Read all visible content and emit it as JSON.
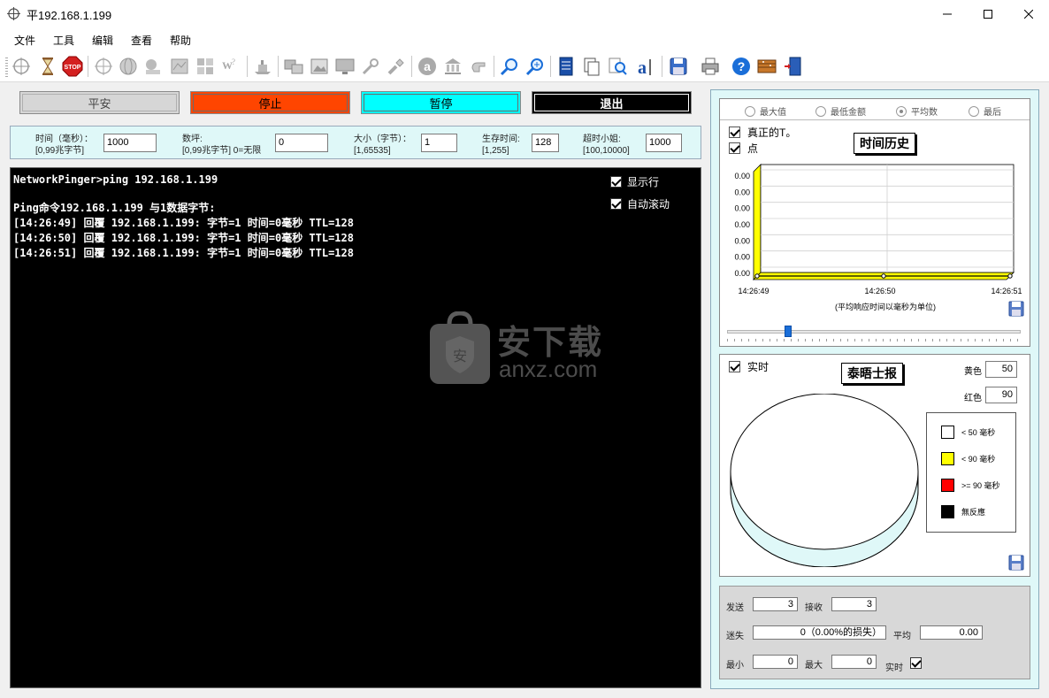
{
  "window": {
    "title": "平192.168.1.199"
  },
  "menu": [
    "文件",
    "工具",
    "编辑",
    "查看",
    "帮助"
  ],
  "toolbar_icons": [
    "ping-target-icon",
    "hourglass-icon",
    "stop-sign-icon",
    "target-icon",
    "globe-icon",
    "tracert-icon",
    "map-icon",
    "grid-icon",
    "whois-icon",
    "ships-icon",
    "monitor-icon",
    "image-icon",
    "screen-icon",
    "tools-icon",
    "flashlight-icon",
    "letter-a-icon",
    "building-icon",
    "hand-icon",
    "magnify-icon",
    "magnify-plus-icon",
    "server-icon",
    "copy-icon",
    "find-icon",
    "text-a-icon",
    "save-icon",
    "printer-icon",
    "help-icon",
    "options-icon",
    "exit-door-icon"
  ],
  "actions": {
    "safe": "平安",
    "stop": "停止",
    "pause": "暂停",
    "exit": "退出"
  },
  "params": {
    "time_label": "时间（毫秒）：",
    "time_range": "[0,99兆字节]",
    "time_value": "1000",
    "count_label": "数坪:",
    "count_range": "[0,99兆字节] 0=无限",
    "count_value": "0",
    "size_label": "大小（字节）：",
    "size_range": "[1,65535]",
    "size_value": "1",
    "ttl_label": "生存时间:",
    "ttl_range": "[1,255]",
    "ttl_value": "128",
    "timeout_label": "超时小姐:",
    "timeout_range": "[100,10000]",
    "timeout_value": "1000"
  },
  "console": {
    "lines": [
      "NetworkPinger>ping 192.168.1.199",
      "",
      "Ping命令192.168.1.199 与1数据字节:",
      "[14:26:49] 回覆 192.168.1.199: 字节=1 时间=0毫秒 TTL=128",
      "[14:26:50] 回覆 192.168.1.199: 字节=1 时间=0毫秒 TTL=128",
      "[14:26:51] 回覆 192.168.1.199: 字节=1 时间=0毫秒 TTL=128"
    ],
    "show_lines_label": "显示行",
    "show_lines_checked": true,
    "autoscroll_label": "自动滚动",
    "autoscroll_checked": true
  },
  "watermark": {
    "cn": "安下载",
    "en": "anxz.com"
  },
  "history": {
    "radios": [
      {
        "label": "最大值",
        "checked": false
      },
      {
        "label": "最低金额",
        "checked": false
      },
      {
        "label": "平均数",
        "checked": true
      },
      {
        "label": "最后",
        "checked": false
      }
    ],
    "real_t_label": "真正的T。",
    "real_t_checked": true,
    "points_label": "点",
    "points_checked": true,
    "title": "时间历史",
    "caption": "(平均响应时间以毫秒为单位)"
  },
  "chart_data": {
    "type": "line",
    "title": "时间历史",
    "xlabel": "(平均响应时间以毫秒为单位)",
    "ylabel": "",
    "x": [
      "14:26:49",
      "14:26:50",
      "14:26:51"
    ],
    "series": [
      {
        "values": [
          0,
          0,
          0
        ]
      }
    ],
    "y_ticks": [
      "0.00",
      "0.00",
      "0.00",
      "0.00",
      "0.00",
      "0.00",
      "0.00"
    ],
    "ylim": [
      0,
      0
    ],
    "grid": true,
    "colors": {
      "wall": "#ffff00",
      "line": "#000000"
    }
  },
  "slider": {
    "value": 0.2
  },
  "pie": {
    "realtime_label": "实时",
    "realtime_checked": true,
    "title": "泰晤士报",
    "yellow_label": "黄色",
    "yellow_value": "50",
    "red_label": "红色",
    "red_value": "90",
    "legend": [
      {
        "label": "< 50 毫秒",
        "color": "#ffffff"
      },
      {
        "label": "< 90 毫秒",
        "color": "#ffff00"
      },
      {
        "label": ">= 90 毫秒",
        "color": "#ff0000"
      },
      {
        "label": "無反應",
        "color": "#000000"
      }
    ]
  },
  "stats": {
    "sent_label": "发送",
    "sent_value": "3",
    "received_label": "接收",
    "received_value": "3",
    "lost_label": "迷失",
    "lost_value": "0（0.00%的损失）",
    "avg_label": "平均",
    "avg_value": "0.00",
    "min_label": "最小",
    "min_value": "0",
    "max_label": "最大",
    "max_value": "0",
    "realtime_label": "实时",
    "realtime_checked": true
  }
}
